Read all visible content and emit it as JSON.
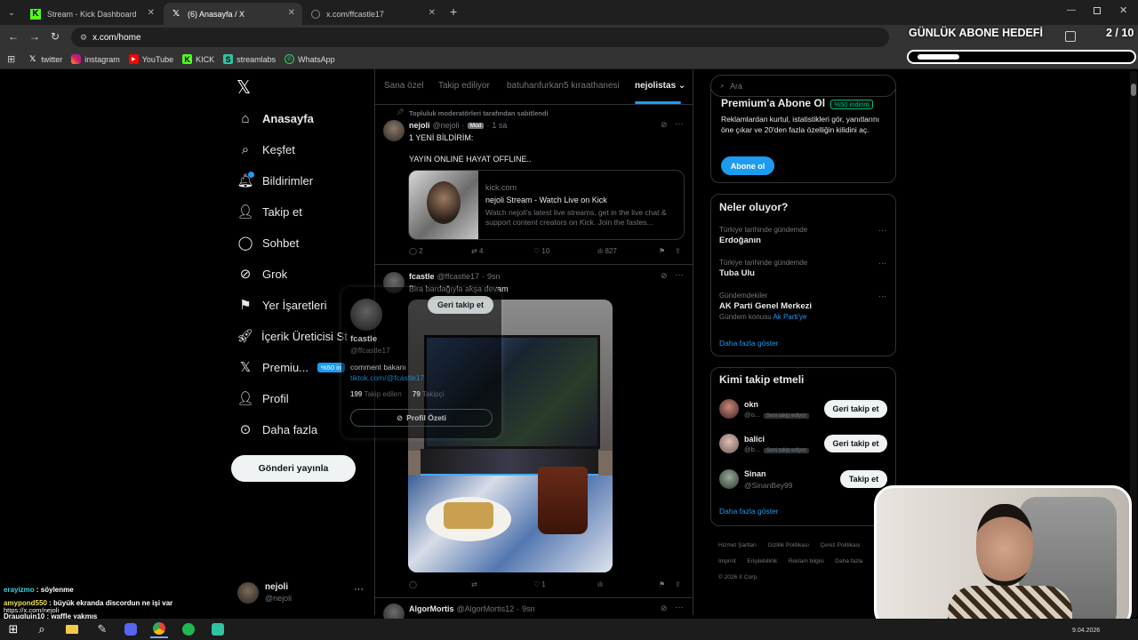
{
  "browser": {
    "tabs": [
      {
        "label": "Stream - Kick Dashboard"
      },
      {
        "label": "(6) Anasayfa / X"
      },
      {
        "label": "x.com/ffcastle17"
      }
    ],
    "url": "x.com/home",
    "bookmarks": [
      "twitter",
      "instagram",
      "YouTube",
      "KICK",
      "streamlabs",
      "WhatsApp"
    ]
  },
  "overlay": {
    "goal_title": "GÜNLÜK ABONE HEDEFİ",
    "goal_count": "2 / 10",
    "goal_progress": 0.2,
    "date": "9.04.2026"
  },
  "nav": {
    "items": [
      "Anasayfa",
      "Keşfet",
      "Bildirimler",
      "Takip et",
      "Sohbet",
      "Grok",
      "Yer İşaretleri",
      "İçerik Üreticisi St...",
      "Premiu...",
      "Profil",
      "Daha fazla"
    ],
    "premium_badge": "%50 in",
    "post_button": "Gönderi yayınla",
    "account": {
      "name": "nejoli",
      "handle": "@nejoli"
    }
  },
  "feed": {
    "tabs": [
      "Sana özel",
      "Takip ediliyor",
      "batuhanfurkan5 kıraathanesi",
      "nejolistas"
    ],
    "pinned_label": "Topluluk moderatörleri tarafından sabitlendi",
    "post1": {
      "name": "nejoli",
      "handle": "@nejoli",
      "badge": "Mod",
      "time": "1 sa",
      "line1": "1 YENİ BİLDİRİM:",
      "line2": "YAYIN ONLINE HAYAT OFFLINE..",
      "card_domain": "kick.com",
      "card_title": "nejoli Stream - Watch Live on Kick",
      "card_desc": "Watch nejoli's latest live streams, get in the live chat & support content creators on Kick. Join the fastes...",
      "replies": "2",
      "reposts": "4",
      "likes": "10",
      "views": "827"
    },
    "post2": {
      "name": "fcastle",
      "handle": "@ffcastle17",
      "time": "9sn",
      "text": "Bira bardağıyla akşa devam",
      "likes": "1"
    },
    "post3": {
      "name": "AlgorMortis",
      "handle": "@AlgorMortis12",
      "time": "9sn"
    }
  },
  "hover_card": {
    "follow_back": "Geri takip et",
    "name": "fcastle",
    "handle": "@ffcastle17",
    "bio": "comment bakanı",
    "link": "tiktok.com/@fcastle17",
    "following_count": "199",
    "following_label": "Takip edilen",
    "followers_count": "79",
    "followers_label": "Takipçi",
    "summary_button": "Profil Özeti"
  },
  "sidebar": {
    "search_placeholder": "Ara",
    "premium": {
      "title": "Premium'a Abone Ol",
      "badge": "%50 indirim",
      "desc": "Reklamlardan kurtul, istatistikleri gör, yanıtlarını öne çıkar ve 20'den fazla özelliğin kilidini aç.",
      "button": "Abone ol"
    },
    "trends": {
      "title": "Neler oluyor?",
      "items": [
        {
          "meta": "Türkiye tarihinde gündemde",
          "name": "Erdoğanın",
          "extra": ""
        },
        {
          "meta": "Türkiye tarihinde gündemde",
          "name": "Tuba Ulu",
          "extra": ""
        },
        {
          "meta": "Gündemdekiler",
          "name": "AK Parti Genel Merkezi",
          "extra": "Gündem konusu"
        }
      ],
      "extra_link": "Ak Parti'ye",
      "show_more": "Daha fazla göster"
    },
    "who_to_follow": {
      "title": "Kimi takip etmeli",
      "users": [
        {
          "name": "okn",
          "handle": "@o...",
          "badge": "Seni takip ediyor",
          "button": "Geri takip et"
        },
        {
          "name": "balici",
          "handle": "@b...",
          "badge": "Seni takip ediyor",
          "button": "Geri takip et"
        },
        {
          "name": "Sinan",
          "handle": "@SinanBey99",
          "badge": "",
          "button": "Takip et"
        }
      ],
      "show_more": "Daha fazla göster"
    },
    "footer": [
      "Hizmet Şartları",
      "Gizlilik Politikası",
      "Çerez Politikası",
      "Imprint",
      "Erişilebilirlik",
      "Reklam bilgisi",
      "Daha fazla"
    ],
    "copyright": "© 2026 X Corp."
  },
  "chat": [
    {
      "user": "erayizmo",
      "msg": "söylenme",
      "color": "#3bd5e6"
    },
    {
      "user": "amypond550",
      "msg": "büyük ekranda discordun ne işi var",
      "color": "#f0e04a"
    },
    {
      "user": "",
      "msg": "https://x.com/nejoli",
      "color": "#ffffff"
    },
    {
      "user": "Draugluin10",
      "msg": "waffle yakmış",
      "color": "#ffffff"
    }
  ]
}
